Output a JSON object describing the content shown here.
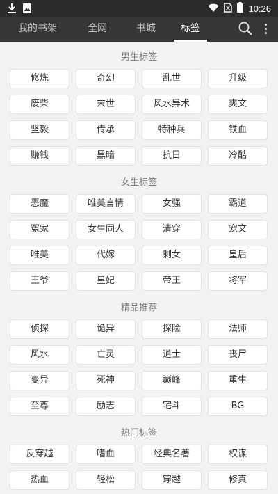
{
  "status_bar": {
    "time": "10:26",
    "icons": [
      "download-icon",
      "image-notification-icon",
      "wifi-icon",
      "no-sim-icon",
      "battery-icon"
    ]
  },
  "nav": {
    "tabs": [
      {
        "label": "我的书架",
        "active": false
      },
      {
        "label": "全网",
        "active": false
      },
      {
        "label": "书城",
        "active": false
      },
      {
        "label": "标签",
        "active": true
      }
    ],
    "icons": [
      "search-icon",
      "more-vert-icon"
    ]
  },
  "sections": [
    {
      "title": "男生标签",
      "tags": [
        "修炼",
        "奇幻",
        "乱世",
        "升级",
        "废柴",
        "末世",
        "风水异术",
        "爽文",
        "坚毅",
        "传承",
        "特种兵",
        "铁血",
        "赚钱",
        "黑暗",
        "抗日",
        "冷酷"
      ]
    },
    {
      "title": "女生标签",
      "tags": [
        "恶魔",
        "唯美言情",
        "女强",
        "霸道",
        "冤家",
        "女生同人",
        "清穿",
        "宠文",
        "唯美",
        "代嫁",
        "剩女",
        "皇后",
        "王爷",
        "皇妃",
        "帝王",
        "将军"
      ]
    },
    {
      "title": "精品推荐",
      "tags": [
        "侦探",
        "诡异",
        "探险",
        "法师",
        "风水",
        "亡灵",
        "道士",
        "丧尸",
        "变异",
        "死神",
        "巅峰",
        "重生",
        "至尊",
        "励志",
        "宅斗",
        "BG"
      ]
    },
    {
      "title": "热门标签",
      "tags": [
        "反穿越",
        "嗜血",
        "经典名著",
        "权谋",
        "热血",
        "轻松",
        "穿越",
        "修真"
      ]
    }
  ],
  "colors": {
    "status_bar": "#2b2b2b",
    "nav_bar": "#363636",
    "background": "#f2f2f2",
    "tag_bg": "#ffffff",
    "tag_border": "#e1e1e1"
  }
}
